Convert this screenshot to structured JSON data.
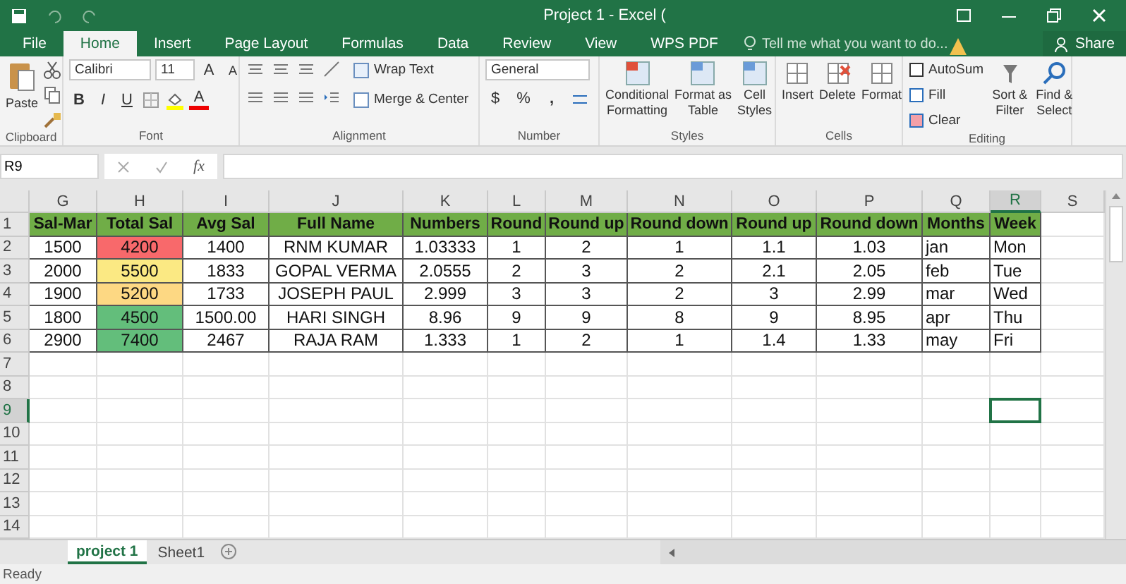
{
  "window": {
    "title": "Project 1 - Excel ("
  },
  "tabs": [
    {
      "label": "File",
      "selected": false
    },
    {
      "label": "Home",
      "selected": true
    },
    {
      "label": "Insert",
      "selected": false
    },
    {
      "label": "Page Layout",
      "selected": false
    },
    {
      "label": "Formulas",
      "selected": false
    },
    {
      "label": "Data",
      "selected": false
    },
    {
      "label": "Review",
      "selected": false
    },
    {
      "label": "View",
      "selected": false
    },
    {
      "label": "WPS PDF",
      "selected": false
    }
  ],
  "tell_me": {
    "placeholder": "Tell me what you want to do..."
  },
  "share": "Share",
  "ribbon": {
    "clipboard": {
      "paste": "Paste",
      "label": "Clipboard"
    },
    "font": {
      "name": "Calibri",
      "size": "11",
      "grow": "A",
      "shrink": "A",
      "bold": "B",
      "italic": "I",
      "underline": "U",
      "color_letter": "A",
      "label": "Font"
    },
    "alignment": {
      "wrap": "Wrap Text",
      "merge": "Merge & Center",
      "label": "Alignment"
    },
    "number": {
      "format": "General",
      "currency": "$",
      "percent": "%",
      "comma": ",",
      "label": "Number"
    },
    "styles": {
      "buttons": [
        [
          "Conditional",
          "Formatting"
        ],
        [
          "Format as",
          "Table"
        ],
        [
          "Cell",
          "Styles"
        ]
      ],
      "label": "Styles"
    },
    "cells": {
      "buttons": [
        "Insert",
        "Delete",
        "Format"
      ],
      "label": "Cells"
    },
    "editing": {
      "small": [
        "AutoSum",
        "Fill",
        "Clear"
      ],
      "large": [
        [
          "Sort &",
          "Filter"
        ],
        [
          "Find &",
          "Select"
        ]
      ],
      "label": "Editing"
    }
  },
  "formula_bar": {
    "name_box": "R9",
    "function_label": "fx"
  },
  "sheet": {
    "columns": [
      {
        "label": "G",
        "selected": false
      },
      {
        "label": "H",
        "selected": false
      },
      {
        "label": "I",
        "selected": false
      },
      {
        "label": "J",
        "selected": false
      },
      {
        "label": "K",
        "selected": false
      },
      {
        "label": "L",
        "selected": false
      },
      {
        "label": "M",
        "selected": false
      },
      {
        "label": "N",
        "selected": false
      },
      {
        "label": "O",
        "selected": false
      },
      {
        "label": "P",
        "selected": false
      },
      {
        "label": "Q",
        "selected": false
      },
      {
        "label": "R",
        "selected": true
      },
      {
        "label": "S",
        "selected": false
      }
    ],
    "header_row": {
      "number": "1",
      "selected": false,
      "cells": [
        "Sal-Mar",
        "Total Sal",
        "Avg Sal",
        "Full Name",
        "Numbers",
        "Round",
        "Round up",
        "Round down",
        "Round up",
        "Round down",
        "Months",
        "Week"
      ]
    },
    "rows": [
      {
        "number": "2",
        "selected": false,
        "cells": [
          {
            "text": "1500"
          },
          {
            "text": "4200",
            "color": "#f8696b"
          },
          {
            "text": "1400"
          },
          {
            "text": "RNM  KUMAR"
          },
          {
            "text": "1.03333"
          },
          {
            "text": "1"
          },
          {
            "text": "2"
          },
          {
            "text": "1"
          },
          {
            "text": "1.1"
          },
          {
            "text": "1.03"
          },
          {
            "text": "jan"
          },
          {
            "text": "Mon"
          }
        ]
      },
      {
        "number": "3",
        "selected": false,
        "cells": [
          {
            "text": "2000"
          },
          {
            "text": "5500",
            "color": "#fbe983"
          },
          {
            "text": "1833"
          },
          {
            "text": "GOPAL  VERMA"
          },
          {
            "text": "2.0555"
          },
          {
            "text": "2"
          },
          {
            "text": "3"
          },
          {
            "text": "2"
          },
          {
            "text": "2.1"
          },
          {
            "text": "2.05"
          },
          {
            "text": "feb"
          },
          {
            "text": "Tue"
          }
        ]
      },
      {
        "number": "4",
        "selected": false,
        "cells": [
          {
            "text": "1900"
          },
          {
            "text": "5200",
            "color": "#fdd883"
          },
          {
            "text": "1733"
          },
          {
            "text": "JOSEPH  PAUL"
          },
          {
            "text": "2.999"
          },
          {
            "text": "3"
          },
          {
            "text": "3"
          },
          {
            "text": "2"
          },
          {
            "text": "3"
          },
          {
            "text": "2.99"
          },
          {
            "text": "mar"
          },
          {
            "text": "Wed"
          }
        ]
      },
      {
        "number": "5",
        "selected": false,
        "cells": [
          {
            "text": "1800"
          },
          {
            "text": "4500",
            "color": "#63be7b"
          },
          {
            "text": "1500.00"
          },
          {
            "text": "HARI  SINGH"
          },
          {
            "text": "8.96"
          },
          {
            "text": "9"
          },
          {
            "text": "9"
          },
          {
            "text": "8"
          },
          {
            "text": "9"
          },
          {
            "text": "8.95"
          },
          {
            "text": "apr"
          },
          {
            "text": "Thu"
          }
        ]
      },
      {
        "number": "6",
        "selected": false,
        "cells": [
          {
            "text": "2900"
          },
          {
            "text": "7400",
            "color": "#63be7b"
          },
          {
            "text": "2467"
          },
          {
            "text": "RAJA  RAM"
          },
          {
            "text": "1.333"
          },
          {
            "text": "1"
          },
          {
            "text": "2"
          },
          {
            "text": "1"
          },
          {
            "text": "1.4"
          },
          {
            "text": "1.33"
          },
          {
            "text": "may"
          },
          {
            "text": "Fri"
          }
        ]
      },
      {
        "number": "7",
        "selected": false
      },
      {
        "number": "8",
        "selected": false
      },
      {
        "number": "9",
        "selected": true
      },
      {
        "number": "10",
        "selected": false
      },
      {
        "number": "11",
        "selected": false
      },
      {
        "number": "12",
        "selected": false
      },
      {
        "number": "13",
        "selected": false
      },
      {
        "number": "14",
        "selected": false
      }
    ]
  },
  "sheet_tabs": [
    {
      "label": "project 1",
      "selected": true
    },
    {
      "label": "Sheet1",
      "selected": false
    }
  ],
  "status_bar": {
    "status": "Ready"
  }
}
